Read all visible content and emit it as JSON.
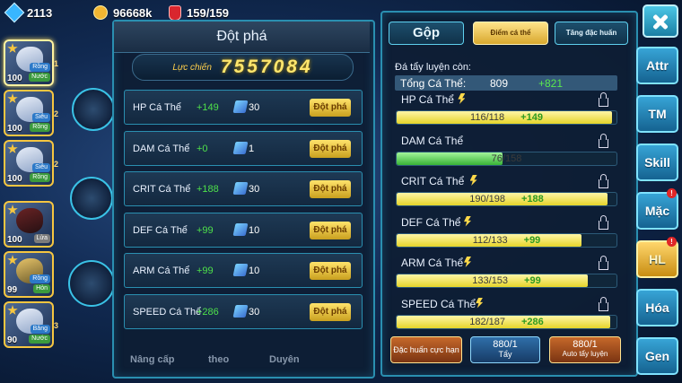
{
  "resources": {
    "gems": "2113",
    "coins": "96668k",
    "stamina": "159/159"
  },
  "heroes": [
    {
      "level": "100",
      "tag1": "Rồng",
      "tag2": "Nước",
      "slot": "1",
      "selected": true
    },
    {
      "level": "100",
      "tag1": "Siêu",
      "tag2": "Rồng",
      "slot": "2"
    },
    {
      "level": "100",
      "tag1": "Siêu",
      "tag2": "Rồng",
      "slot": "2"
    },
    {
      "level": "100",
      "tag1": "",
      "tag2": "Lửa",
      "slot": ""
    },
    {
      "level": "99",
      "tag1": "Rồng",
      "tag2": "Hỏn",
      "slot": ""
    },
    {
      "level": "90",
      "tag1": "Băng",
      "tag2": "Nước",
      "slot": "3"
    }
  ],
  "breakthrough": {
    "title": "Đột phá",
    "power_label": "Lực chiến",
    "power_value": "7557084",
    "rows": [
      {
        "name": "HP Cá Thể",
        "bonus": "+149",
        "cost": "30",
        "button": "Đột phá"
      },
      {
        "name": "DAM Cá Thể",
        "bonus": "+0",
        "cost": "1",
        "button": "Đột phá"
      },
      {
        "name": "CRIT Cá Thể",
        "bonus": "+188",
        "cost": "30",
        "button": "Đột phá"
      },
      {
        "name": "DEF Cá Thể",
        "bonus": "+99",
        "cost": "10",
        "button": "Đột phá"
      },
      {
        "name": "ARM Cá Thể",
        "bonus": "+99",
        "cost": "10",
        "button": "Đột phá"
      },
      {
        "name": "SPEED Cá Thể",
        "bonus": "+286",
        "cost": "30",
        "button": "Đột phá"
      }
    ],
    "bottom_tabs": [
      "Nâng cấp",
      "theo",
      "Duyên"
    ]
  },
  "training": {
    "tabs": [
      "Gộp",
      "Điểm cá thể",
      "Tăng đặc huấn"
    ],
    "remain_label": "Đá tẩy luyện còn:",
    "total_label": "Tổng Cá Thể:",
    "total_value": "809",
    "total_bonus": "+821",
    "stats": [
      {
        "label": "HP Cá Thể",
        "value": "116/118",
        "bonus": "+149",
        "fill": 0.98,
        "color": "y",
        "bolt": true
      },
      {
        "label": "DAM Cá Thể",
        "value": "76/158",
        "bonus": "",
        "fill": 0.48,
        "color": "g",
        "bolt": false
      },
      {
        "label": "CRIT Cá Thể",
        "value": "190/198",
        "bonus": "+188",
        "fill": 0.96,
        "color": "y",
        "bolt": true
      },
      {
        "label": "DEF Cá Thể",
        "value": "112/133",
        "bonus": "+99",
        "fill": 0.84,
        "color": "y",
        "bolt": true
      },
      {
        "label": "ARM Cá Thể",
        "value": "133/153",
        "bonus": "+99",
        "fill": 0.87,
        "color": "y",
        "bolt": true
      },
      {
        "label": "SPEED Cá Thể",
        "value": "182/187",
        "bonus": "+286",
        "fill": 0.97,
        "color": "y",
        "bolt": true
      }
    ],
    "buttons": {
      "special": "Đặc huấn cực hạn",
      "wash_count": "880/1",
      "wash_label": "Tẩy",
      "auto_count": "880/1",
      "auto_label": "Auto tẩy luyện"
    }
  },
  "nav": [
    "Attr",
    "TM",
    "Skill",
    "Mặc",
    "HL",
    "Hóa",
    "Gen"
  ],
  "nav_badges": {
    "Mặc": "!",
    "HL": "!"
  }
}
